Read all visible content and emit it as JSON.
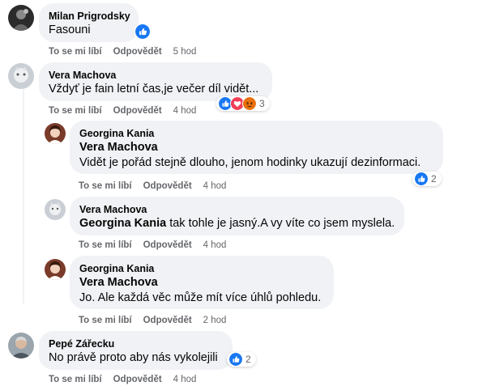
{
  "labels": {
    "like": "To se mi líbí",
    "reply": "Odpovědět"
  },
  "colors": {
    "bubble": "#f0f2f5",
    "like_blue": "#1877f2",
    "love_red": "#f33e58",
    "angry_orange": "#e9710f",
    "meta_text": "#65676b"
  },
  "comments": [
    {
      "author": "Milan Prigrodsky",
      "text": "Fasouni",
      "time": "5 hod",
      "reactions": [
        "like-icon"
      ],
      "reaction_count": ""
    },
    {
      "author": "Vera Machova",
      "text": "Vždyť je fain letní čas,je večer díl vidět...",
      "time": "4 hod",
      "reactions": [
        "like-icon",
        "love-icon",
        "angry-icon"
      ],
      "reaction_count": "3"
    },
    {
      "author": "Georgina Kania",
      "tag": "Vera Machova",
      "text": "Vidět je pořád stejně dlouho, jenom hodinky ukazují dezinformaci.",
      "time": "4 hod",
      "reactions": [
        "like-icon"
      ],
      "reaction_count": "2"
    },
    {
      "author": "Vera Machova",
      "tag": "Georgina Kania",
      "text": "tak tohle je jasný.A vy víte co jsem myslela.",
      "time": "4 hod",
      "reactions": [],
      "reaction_count": ""
    },
    {
      "author": "Georgina Kania",
      "tag": "Vera Machova",
      "text": "Jo. Ale každá věc může mít více úhlů pohledu.",
      "time": "2 hod",
      "reactions": [],
      "reaction_count": ""
    },
    {
      "author": "Pepé Zářecku",
      "text": "No právě proto aby nás vykolejili",
      "time": "4 hod",
      "reactions": [
        "like-icon"
      ],
      "reaction_count": "2"
    }
  ]
}
